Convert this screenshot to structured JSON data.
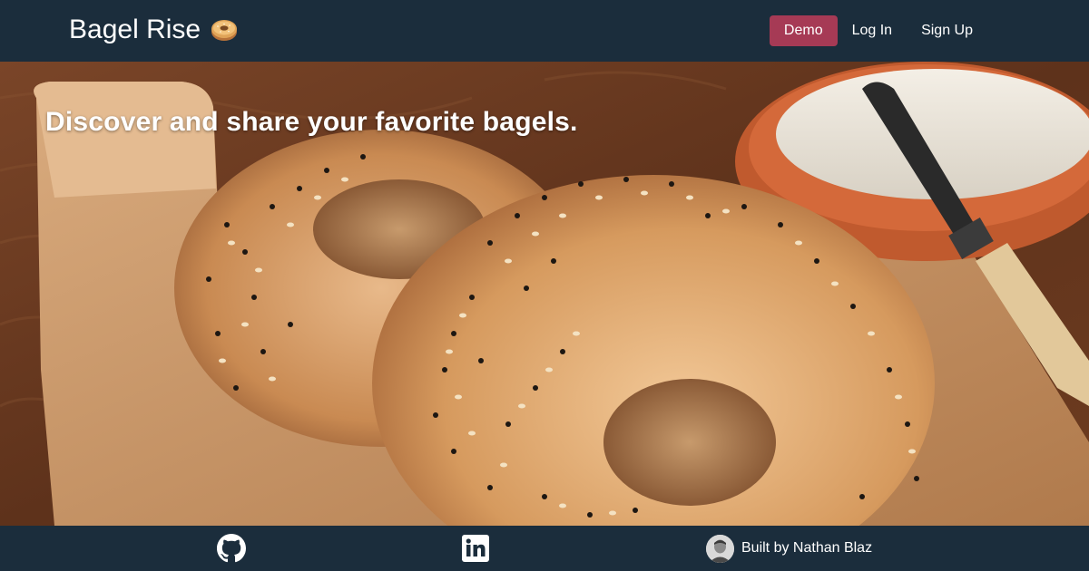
{
  "navbar": {
    "brand_title": "Bagel Rise",
    "brand_icon": "bagel-icon",
    "links": {
      "demo": "Demo",
      "login": "Log In",
      "signup": "Sign Up"
    }
  },
  "hero": {
    "tagline": "Discover and share your favorite bagels.",
    "image": "photo of seeded bagels on a wooden board with cream cheese bowl and knife"
  },
  "footer": {
    "github_icon": "github-icon",
    "linkedin_icon": "linkedin-icon",
    "author_text": "Built by Nathan Blaz",
    "avatar_icon": "avatar"
  },
  "colors": {
    "nav_background": "#1b2d3c",
    "demo_button": "#a63a55",
    "text": "#ffffff"
  }
}
